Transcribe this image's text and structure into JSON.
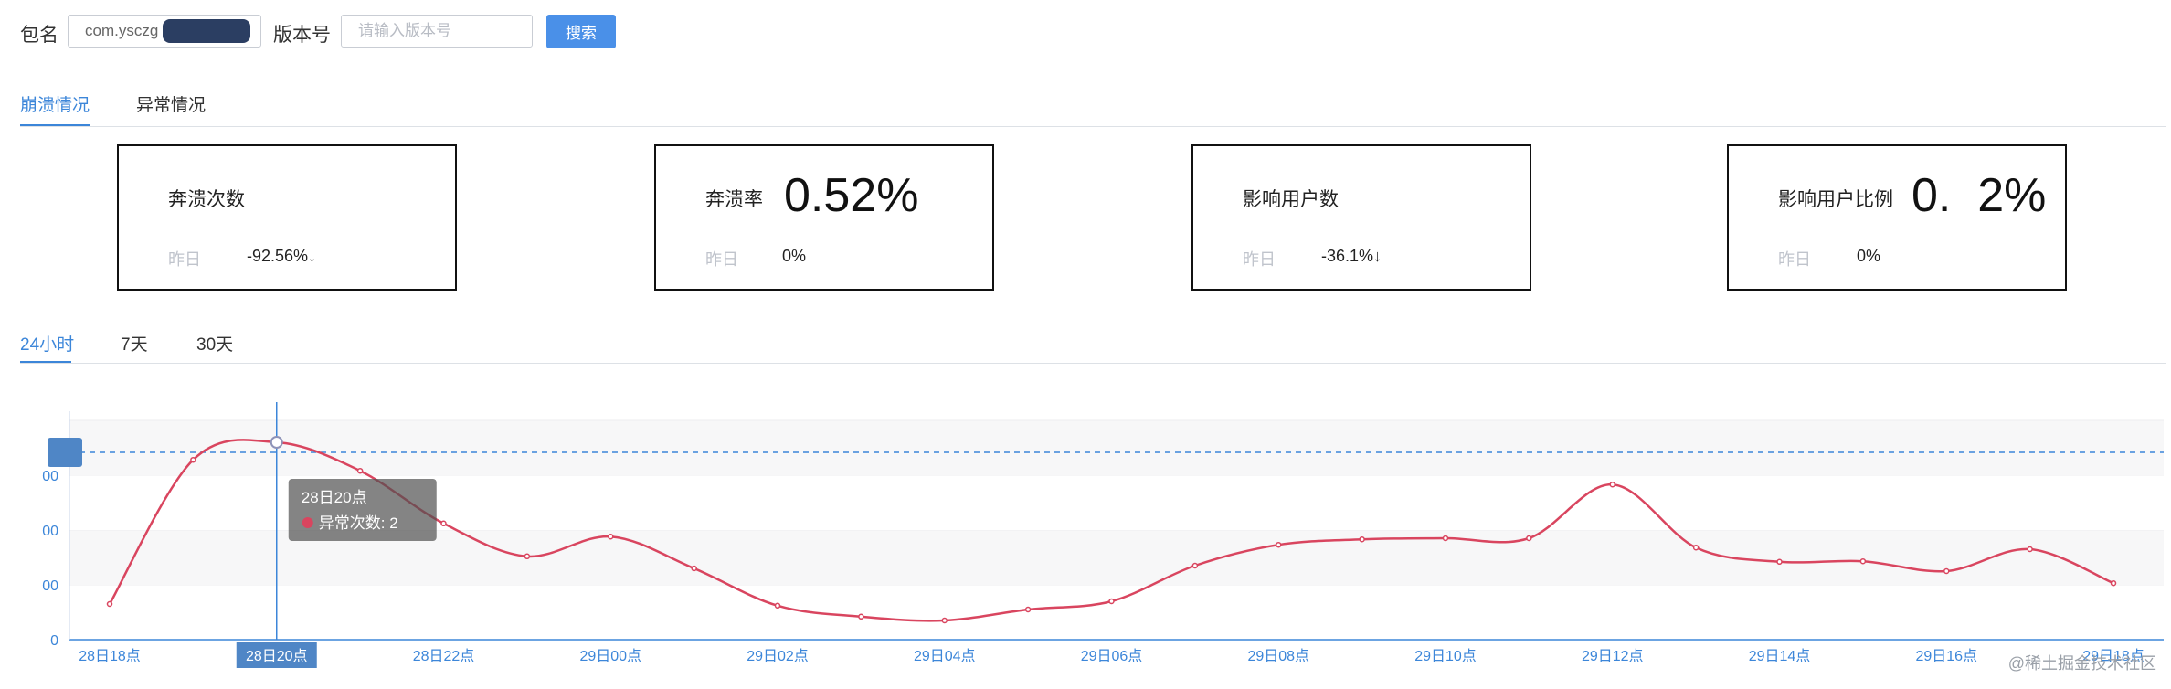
{
  "search": {
    "package_label": "包名",
    "package_value": "com.ysczg",
    "version_label": "版本号",
    "version_placeholder": "请输入版本号",
    "search_button": "搜索"
  },
  "tabs": [
    {
      "label": "崩溃情况",
      "active": true
    },
    {
      "label": "异常情况",
      "active": false
    }
  ],
  "stats": [
    {
      "name": "奔溃次数",
      "value": "",
      "yesterday_label": "昨日",
      "yesterday_value": "-92.56%↓"
    },
    {
      "name": "奔溃率",
      "value": "0.52%",
      "yesterday_label": "昨日",
      "yesterday_value": "0%"
    },
    {
      "name": "影响用户数",
      "value": "",
      "yesterday_label": "昨日",
      "yesterday_value": "-36.1%↓"
    },
    {
      "name": "影响用户比例",
      "value": "0.  2%",
      "yesterday_label": "昨日",
      "yesterday_value": "0%"
    }
  ],
  "range_tabs": [
    {
      "label": "24小时",
      "active": true
    },
    {
      "label": "7天",
      "active": false
    },
    {
      "label": "30天",
      "active": false
    }
  ],
  "colors": {
    "accent": "#3c86d9",
    "series": "#d9455f",
    "button": "#4a90e8"
  },
  "chart_data": {
    "type": "line",
    "x": [
      "28日18点",
      "28日19点",
      "28日20点",
      "28日21点",
      "28日22点",
      "28日23点",
      "29日00点",
      "29日01点",
      "29日02点",
      "29日03点",
      "29日04点",
      "29日05点",
      "29日06点",
      "29日07点",
      "29日08点",
      "29日09点",
      "29日10点",
      "29日11点",
      "29日12点",
      "29日13点",
      "29日14点",
      "29日15点",
      "29日16点",
      "29日17点",
      "29日18点"
    ],
    "x_tick_labels": [
      "28日18点",
      "28日20点",
      "28日22点",
      "29日00点",
      "29日02点",
      "29日04点",
      "29日06点",
      "29日08点",
      "29日10点",
      "29日12点",
      "29日14点",
      "29日16点",
      "29日18点"
    ],
    "series": [
      {
        "name": "异常次数",
        "values": [
          65,
          328,
          360,
          308,
          212,
          152,
          188,
          130,
          62,
          42,
          35,
          55,
          70,
          135,
          173,
          183,
          185,
          185,
          283,
          168,
          142,
          143,
          125,
          165,
          103
        ]
      }
    ],
    "y_tick_labels": [
      "0",
      "00",
      "00",
      "00"
    ],
    "ylim": [
      0,
      400
    ],
    "highlight": {
      "index": 2,
      "label": "28日20点",
      "series_label": "异常次数: 2"
    },
    "grid": true,
    "legend": "none"
  },
  "watermark": "@稀土掘金技术社区"
}
